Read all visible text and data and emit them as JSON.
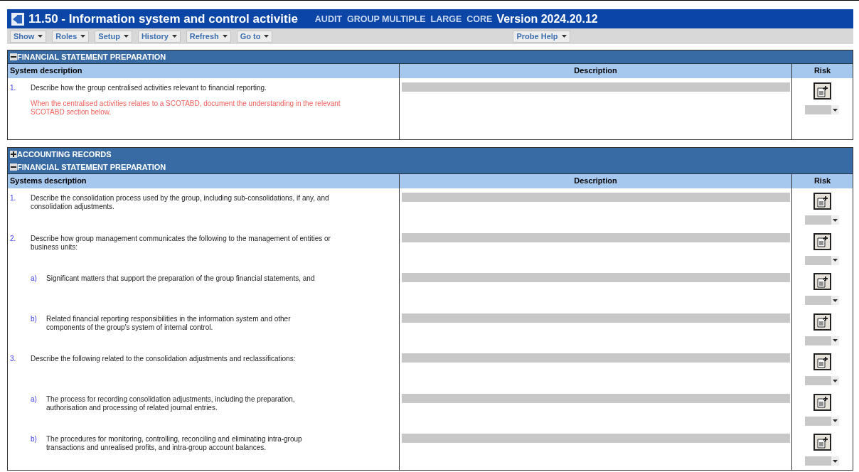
{
  "window": {
    "title": "11.50 - Information system and control activitie",
    "tags": "AUDIT  GROUP MULTIPLE  LARGE  CORE",
    "version": "Version 2024.20.12"
  },
  "menu": [
    {
      "label": "Show"
    },
    {
      "label": "Roles"
    },
    {
      "label": "Setup"
    },
    {
      "label": "History"
    },
    {
      "label": "Refresh"
    },
    {
      "label": "Go to"
    }
  ],
  "help_menu": {
    "label": "Probe Help"
  },
  "panels": [
    {
      "sections": [
        {
          "title": "FINANCIAL STATEMENT PREPARATION",
          "expanded": true
        }
      ],
      "columns": [
        "System description",
        "Description",
        "Risk"
      ],
      "rows": [
        {
          "kind": "item",
          "marker": "1.",
          "text": "Describe how the group centralised activities relevant to financial reporting.",
          "note": "When the centralised activities relates to a SCOTABD, document the understanding in the relevant SCOTABD section below."
        }
      ]
    },
    {
      "sections": [
        {
          "title": "ACCOUNTING RECORDS",
          "expanded": false
        },
        {
          "title": "FINANCIAL STATEMENT PREPARATION",
          "expanded": true
        }
      ],
      "columns": [
        "Systems description",
        "Description",
        "Risk"
      ],
      "rows": [
        {
          "kind": "item",
          "marker": "1.",
          "text": "Describe the consolidation process used by the group, including sub-consolidations, if any, and consolidation adjustments."
        },
        {
          "kind": "item",
          "marker": "2.",
          "text": "Describe how group management communicates the following to the management of entities or business units:"
        },
        {
          "kind": "subitem",
          "marker": "a)",
          "text": "Significant matters that support the preparation of the group financial statements, and"
        },
        {
          "kind": "subitem",
          "marker": "b)",
          "text": "Related financial reporting responsibilities in the information system and other components of the group's system of internal control."
        },
        {
          "kind": "item",
          "marker": "3.",
          "text": "Describe the following related to the consolidation adjustments and reclassifications:"
        },
        {
          "kind": "subitem",
          "marker": "a)",
          "text": "The process for recording consolidation adjustments, including the preparation, authorisation and processing of related journal entries."
        },
        {
          "kind": "subitem",
          "marker": "b)",
          "text": "The procedures for monitoring, controlling, reconciling and eliminating intra-group transactions and unrealised profits, and intra-group account balances."
        }
      ]
    }
  ]
}
